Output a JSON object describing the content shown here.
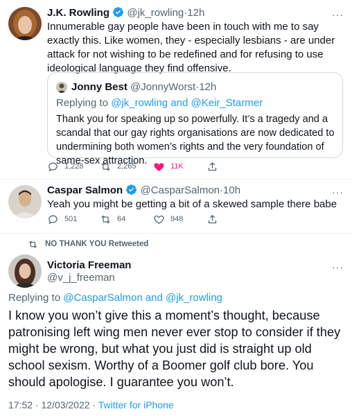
{
  "tweet1": {
    "name": "J.K. Rowling",
    "handle": "@jk_rowling",
    "dot": "·",
    "time": "12h",
    "text": "Innumerable gay people have been in touch with me to say exactly this. Like women, they - especially lesbians - are under attack for not wishing to be redefined and for refusing to use ideological language they find offensive.",
    "quote": {
      "name": "Jonny Best",
      "handle": "@JonnyWorst",
      "dot": "·",
      "time": "12h",
      "replying_prefix": "Replying to",
      "replying_users": "@jk_rowling and @Keir_Starmer",
      "text": "Thank you for speaking up so powerfully. It’s a tragedy and a scandal that our gay rights organisations are now dedicated to undermining both women’s rights and the very foundation of same-sex attraction."
    },
    "replies": "1,228",
    "retweets": "2,265",
    "likes": "11K"
  },
  "tweet2": {
    "name": "Caspar Salmon",
    "handle": "@CasparSalmon",
    "dot": "·",
    "time": "10h",
    "text": "Yeah you might be getting a bit of a skewed sample there babe",
    "replies": "501",
    "retweets": "64",
    "likes": "948"
  },
  "retweet_banner": "NO THANK YOU Retweeted",
  "tweet3": {
    "name": "Victoria Freeman",
    "handle": "@v_j_freeman",
    "replying_prefix": "Replying to",
    "replying_users": "@CasparSalmon and @jk_rowling",
    "text": "I know you won’t give this a moment’s thought, because patronising left wing men never ever stop to consider if they might be wrong, but what you just did is straight up old school sexism. Worthy of a Boomer golf club bore. You should apologise. I guarantee you won’t.",
    "timestamp": "17:52 · 12/03/2022 · ",
    "source": "Twitter for iPhone"
  },
  "more_glyph": "···",
  "colors": {
    "accent": "#1d9bf0",
    "like_pink": "#f91880",
    "muted": "#536471",
    "border": "#cfd9de"
  }
}
